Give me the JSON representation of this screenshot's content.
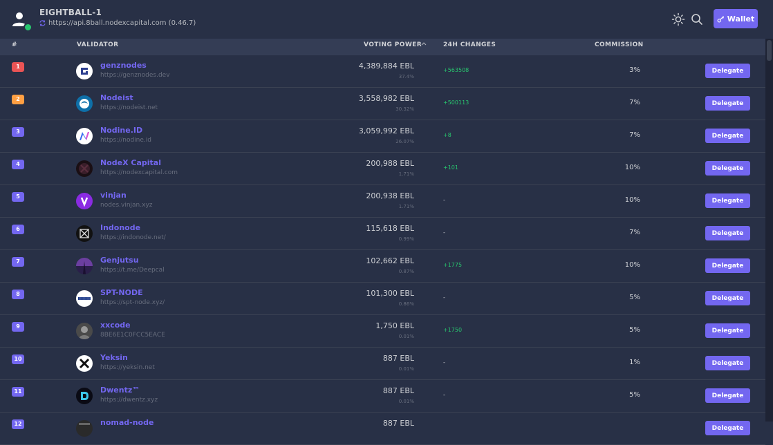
{
  "header": {
    "chain_name": "EIGHTBALL-1",
    "endpoint": "https://api.8ball.nodexcapital.com (0.46.7)",
    "wallet_label": "Wallet",
    "icons": {
      "user": "user-icon",
      "sync": "sync-icon",
      "theme": "sun-icon",
      "search": "search-icon",
      "wallet": "key-icon"
    }
  },
  "table": {
    "columns": {
      "rank": "#",
      "validator": "VALIDATOR",
      "power": "VOTING POWER",
      "changes": "24H CHANGES",
      "commission": "COMMISSION"
    },
    "delegate_label": "Delegate",
    "rows": [
      {
        "rank": "1",
        "name": "genznodes",
        "site": "https://genznodes.dev",
        "power": "4,389,884 EBL",
        "pct": "37.4%",
        "change": "+563508",
        "commission": "3%",
        "badge": "#ea5455",
        "avatar": "genznodes-logo"
      },
      {
        "rank": "2",
        "name": "Nodeist",
        "site": "https://nodeist.net",
        "power": "3,558,982 EBL",
        "pct": "30.32%",
        "change": "+500113",
        "commission": "7%",
        "badge": "#ff9f43",
        "avatar": "nodeist-logo"
      },
      {
        "rank": "3",
        "name": "Nodine.ID",
        "site": "https://nodine.id",
        "power": "3,059,992 EBL",
        "pct": "26.07%",
        "change": "+8",
        "commission": "7%",
        "badge": "#7367f0",
        "avatar": "nodine-logo"
      },
      {
        "rank": "4",
        "name": "NodeX Capital",
        "site": "https://nodexcapital.com",
        "power": "200,988 EBL",
        "pct": "1.71%",
        "change": "+101",
        "commission": "10%",
        "badge": "#7367f0",
        "avatar": "nodex-logo"
      },
      {
        "rank": "5",
        "name": "vinjan",
        "site": "nodes.vinjan.xyz",
        "power": "200,938 EBL",
        "pct": "1.71%",
        "change": "-",
        "commission": "10%",
        "badge": "#7367f0",
        "avatar": "vinjan-logo"
      },
      {
        "rank": "6",
        "name": "Indonode",
        "site": "https://indonode.net/",
        "power": "115,618 EBL",
        "pct": "0.99%",
        "change": "-",
        "commission": "7%",
        "badge": "#7367f0",
        "avatar": "indonode-logo"
      },
      {
        "rank": "7",
        "name": "Genjutsu",
        "site": "https://t.me/Deepcal",
        "power": "102,662 EBL",
        "pct": "0.87%",
        "change": "+1775",
        "commission": "10%",
        "badge": "#7367f0",
        "avatar": "genjutsu-logo"
      },
      {
        "rank": "8",
        "name": "SPT-NODE",
        "site": "https://spt-node.xyz/",
        "power": "101,300 EBL",
        "pct": "0.86%",
        "change": "-",
        "commission": "5%",
        "badge": "#7367f0",
        "avatar": "sptnode-logo"
      },
      {
        "rank": "9",
        "name": "xxcode",
        "site": "8BE6E1C0FCC5EACE",
        "power": "1,750 EBL",
        "pct": "0.01%",
        "change": "+1750",
        "commission": "5%",
        "badge": "#7367f0",
        "avatar": "xxcode-logo"
      },
      {
        "rank": "10",
        "name": "Yeksin",
        "site": "https://yeksin.net",
        "power": "887 EBL",
        "pct": "0.01%",
        "change": "-",
        "commission": "1%",
        "badge": "#7367f0",
        "avatar": "yeksin-logo"
      },
      {
        "rank": "11",
        "name": "Dwentz™",
        "site": "https://dwentz.xyz",
        "power": "887 EBL",
        "pct": "0.01%",
        "change": "-",
        "commission": "5%",
        "badge": "#7367f0",
        "avatar": "dwentz-logo"
      },
      {
        "rank": "12",
        "name": "nomad-node",
        "site": "",
        "power": "887 EBL",
        "pct": "",
        "change": "",
        "commission": "",
        "badge": "#7367f0",
        "avatar": "nomad-logo"
      }
    ]
  },
  "colors": {
    "accent": "#7367f0",
    "positive": "#28c76f",
    "background": "#283046",
    "header_bg": "#343d55"
  }
}
